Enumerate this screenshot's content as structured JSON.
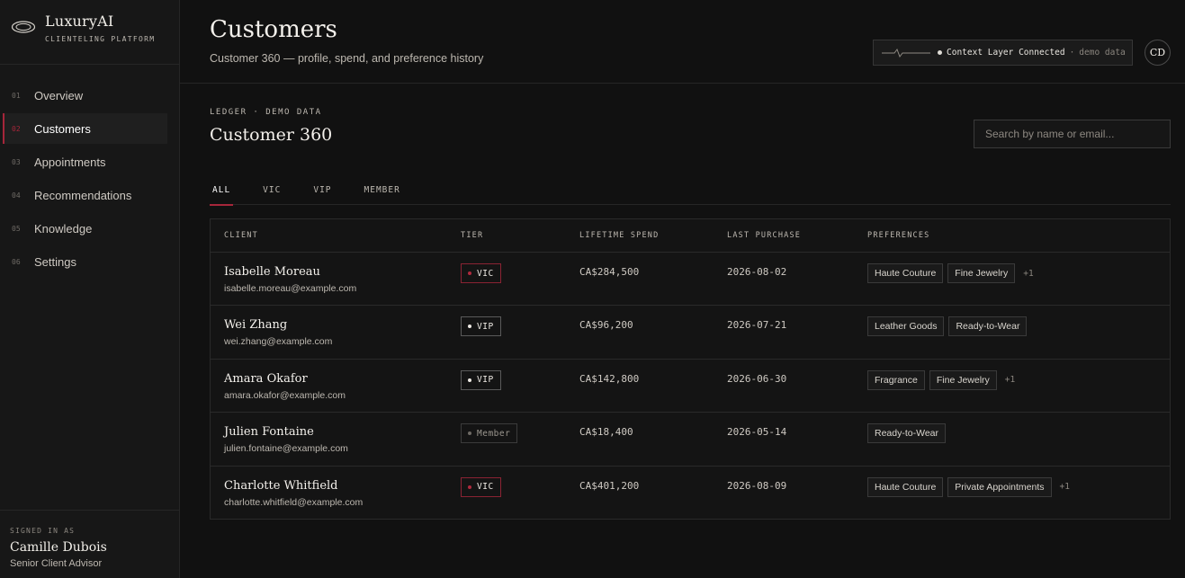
{
  "brand": {
    "name": "LuxuryAI",
    "subtitle": "CLIENTELING PLATFORM"
  },
  "nav": [
    {
      "num": "01",
      "label": "Overview"
    },
    {
      "num": "02",
      "label": "Customers"
    },
    {
      "num": "03",
      "label": "Appointments"
    },
    {
      "num": "04",
      "label": "Recommendations"
    },
    {
      "num": "05",
      "label": "Knowledge"
    },
    {
      "num": "06",
      "label": "Settings"
    }
  ],
  "nav_active": "Customers",
  "user": {
    "caption": "SIGNED IN AS",
    "name": "Camille Dubois",
    "role": "Senior Client Advisor"
  },
  "header": {
    "title": "Customers",
    "subtitle": "Customer 360 — profile, spend, and preference history",
    "status": "Context Layer Connected",
    "status_sep": "·",
    "status_note": "demo data",
    "avatar_initials": "CD"
  },
  "section": {
    "eyebrow": "LEDGER · DEMO DATA",
    "title": "Customer 360",
    "search_placeholder": "Search by name or email..."
  },
  "tabs": [
    "ALL",
    "VIC",
    "VIP",
    "MEMBER"
  ],
  "tab_active": "ALL",
  "table": {
    "headers": [
      "CLIENT",
      "TIER",
      "LIFETIME SPEND",
      "LAST PURCHASE",
      "PREFERENCES"
    ],
    "rows": [
      {
        "name": "Isabelle Moreau",
        "email": "isabelle.moreau@example.com",
        "tier": "VIC",
        "spend": "CA$284,500",
        "last": "2026-08-02",
        "prefs": [
          "Haute Couture",
          "Fine Jewelry"
        ],
        "more": "+1"
      },
      {
        "name": "Wei Zhang",
        "email": "wei.zhang@example.com",
        "tier": "VIP",
        "spend": "CA$96,200",
        "last": "2026-07-21",
        "prefs": [
          "Leather Goods",
          "Ready-to-Wear"
        ],
        "more": ""
      },
      {
        "name": "Amara Okafor",
        "email": "amara.okafor@example.com",
        "tier": "VIP",
        "spend": "CA$142,800",
        "last": "2026-06-30",
        "prefs": [
          "Fragrance",
          "Fine Jewelry"
        ],
        "more": "+1"
      },
      {
        "name": "Julien Fontaine",
        "email": "julien.fontaine@example.com",
        "tier": "Member",
        "spend": "CA$18,400",
        "last": "2026-05-14",
        "prefs": [
          "Ready-to-Wear"
        ],
        "more": ""
      },
      {
        "name": "Charlotte Whitfield",
        "email": "charlotte.whitfield@example.com",
        "tier": "VIC",
        "spend": "CA$401,200",
        "last": "2026-08-09",
        "prefs": [
          "Haute Couture",
          "Private Appointments"
        ],
        "more": "+1"
      }
    ]
  },
  "colors": {
    "accent": "#a6263a",
    "background": "#111111",
    "panel": "#171717"
  },
  "icons": {
    "logo": "ring-logo-icon",
    "status": "pulse-line-icon"
  }
}
